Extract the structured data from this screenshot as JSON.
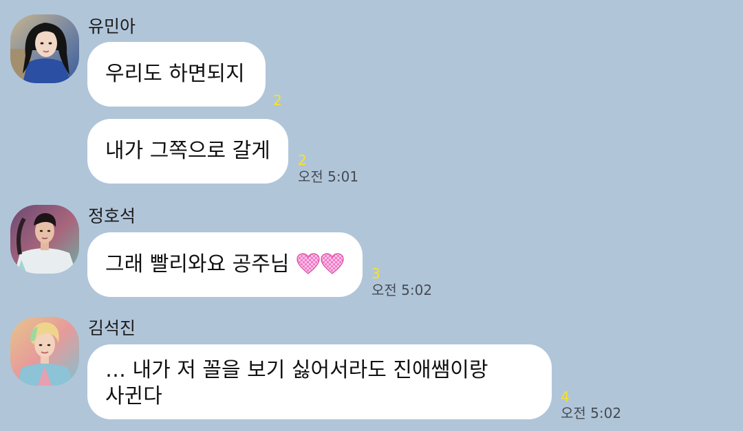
{
  "chat": {
    "groups": [
      {
        "sender": "유민아",
        "avatar_icon": "profile-photo-woman-dark-hair",
        "messages": [
          {
            "text": "우리도 하면되지",
            "unread": "2",
            "time": ""
          },
          {
            "text": "내가 그쪽으로 갈게",
            "unread": "2",
            "time": "오전 5:01"
          }
        ]
      },
      {
        "sender": "정호석",
        "avatar_icon": "profile-photo-man-white-shirt",
        "messages": [
          {
            "text": "그래 빨리와요 공주님",
            "emoji": [
              "pink-checkered-heart-emoji",
              "pink-checkered-heart-emoji"
            ],
            "unread": "3",
            "time": "오전 5:02"
          }
        ]
      },
      {
        "sender": "김석진",
        "avatar_icon": "profile-photo-man-blond-hair",
        "messages": [
          {
            "text_line1": "… 내가 저 꼴을 보기 싫어서라도 진애쌤이랑",
            "text_line2": "사귄다",
            "unread": "4",
            "time": "오전 5:02"
          }
        ]
      }
    ]
  },
  "colors": {
    "background": "#b1c5d9",
    "bubble": "#ffffff",
    "unread_count": "#f7e22a",
    "timestamp": "#444a52"
  }
}
